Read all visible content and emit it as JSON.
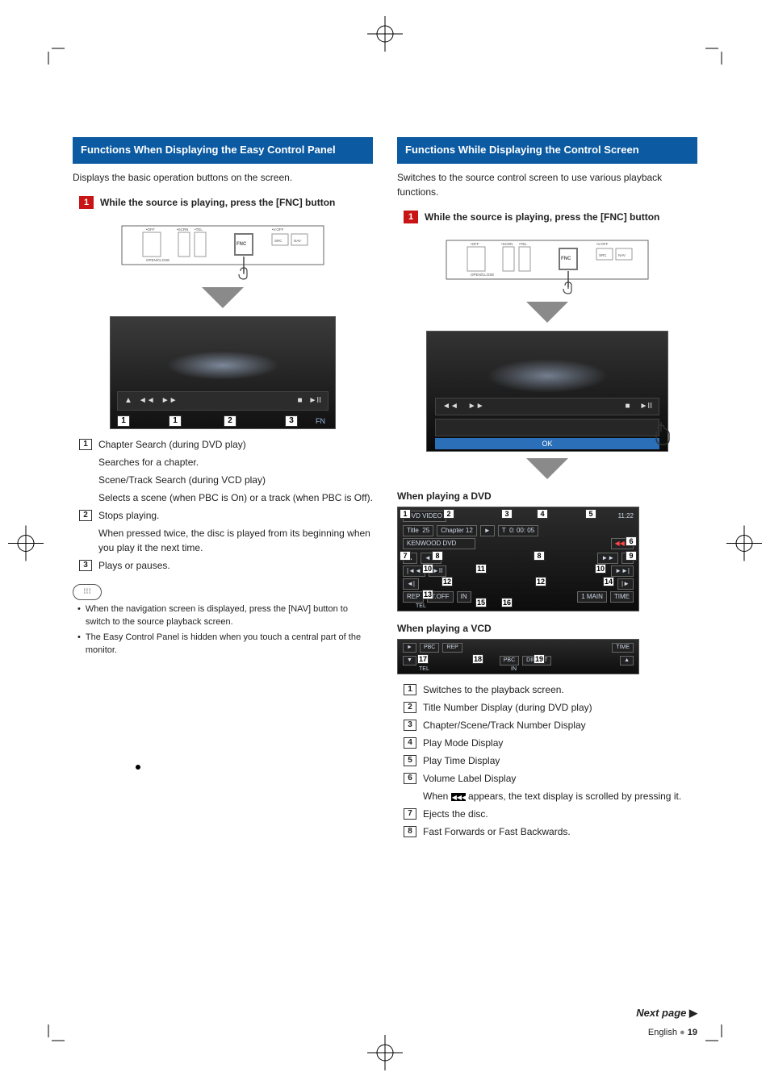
{
  "left": {
    "header": "Functions When Displaying the Easy Control Panel",
    "intro": "Displays the basic operation buttons on the screen.",
    "step1_num": "1",
    "step1": "While the source is playing, press the [FNC] button",
    "device_labels": {
      "off": "OFF",
      "open": "OPEN/CLOSE",
      "scrn": "SCRN",
      "tel": "TEL",
      "vof": "V.OFF",
      "fnc": "FNC",
      "src": "SRC",
      "nav": "NAV"
    },
    "callouts": {
      "n1": "1",
      "n2": "2",
      "n3": "3"
    },
    "fn_label": "FN",
    "items": [
      {
        "num": "1",
        "title": "Chapter Search (during DVD play)",
        "subs": [
          "Searches for a chapter.",
          "Scene/Track Search (during VCD play)",
          "Selects a scene (when PBC is On) or a track (when PBC is Off)."
        ]
      },
      {
        "num": "2",
        "title": "Stops playing.",
        "subs": [
          "When pressed twice, the disc is played from its beginning when you play it the next time."
        ]
      },
      {
        "num": "3",
        "title": "Plays or pauses.",
        "subs": []
      }
    ],
    "notes": [
      "When the navigation screen is displayed, press the [NAV] button to switch to the source playback screen.",
      "The Easy Control Panel is hidden when you touch a central part of the monitor."
    ]
  },
  "right": {
    "header": "Functions While Displaying the Control Screen",
    "intro": "Switches to the source control screen to use various playback functions.",
    "step1_num": "1",
    "step1": "While the source is playing, press the [FNC] button",
    "device_labels": {
      "off": "OFF",
      "open": "OPEN/CLOSE",
      "scrn": "SCRN",
      "tel": "TEL",
      "vof": "V.OFF",
      "fnc": "FNC",
      "src": "SRC",
      "nav": "NAV"
    },
    "ok_label": "OK",
    "sub_dvd": "When playing a DVD",
    "dvd": {
      "header": "DVD VIDEO",
      "title_label": "Title",
      "title_val": "25",
      "chapter_label": "Chapter",
      "chapter_val": "12",
      "time_prefix": "T",
      "time": "0: 00: 05",
      "clock": "11:22",
      "mode": "IN",
      "vol": "KENWOOD DVD",
      "rep": "REP",
      "t_off": "T.OFF",
      "main": "1 MAIN",
      "time_btn": "TIME",
      "tel": "TEL"
    },
    "sub_vcd": "When playing a VCD",
    "vcd": {
      "pbc": "PBC",
      "rep": "REP",
      "time": "TIME",
      "tel": "TEL",
      "btn_pbc": "PBC",
      "btn_dir": "DIRECT",
      "in": "IN"
    },
    "items2": [
      {
        "num": "1",
        "title": "Switches to the playback screen."
      },
      {
        "num": "2",
        "title": "Title Number Display (during DVD play)"
      },
      {
        "num": "3",
        "title": "Chapter/Scene/Track Number Display"
      },
      {
        "num": "4",
        "title": "Play Mode Display"
      },
      {
        "num": "5",
        "title": "Play Time Display"
      },
      {
        "num": "6",
        "title": "Volume Label Display"
      },
      {
        "num": "7",
        "title": "Ejects the disc."
      },
      {
        "num": "8",
        "title": "Fast Forwards or Fast Backwards."
      }
    ],
    "item6_sub_pre": "When ",
    "item6_sub_post": " appears, the text display is scrolled by pressing it.",
    "scroll_glyph": "◀◀◀"
  },
  "footer": {
    "next": "Next page",
    "lang": "English",
    "page": "19"
  }
}
